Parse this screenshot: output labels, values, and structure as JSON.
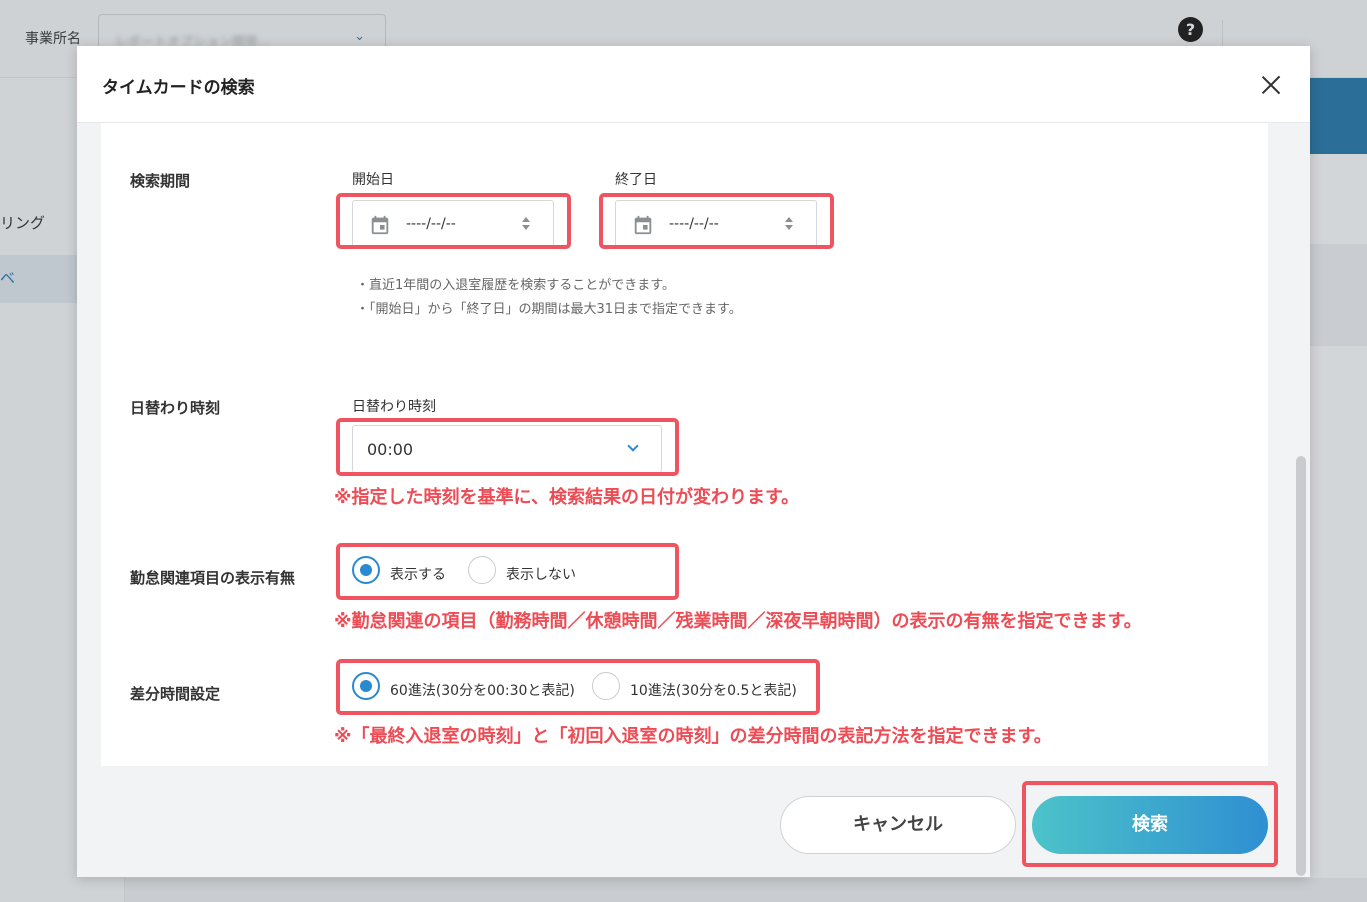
{
  "background": {
    "office_label": "事業所名",
    "office_value": "レポートオプション開発...",
    "help_icon": "?",
    "sidebar_item": "リング",
    "sidebar_active": "ベ"
  },
  "modal": {
    "title": "タイムカードの検索",
    "close_icon": "close-icon"
  },
  "search_period": {
    "label": "検索期間",
    "start_label": "開始日",
    "start_value": "----/--/--",
    "end_label": "終了日",
    "end_value": "----/--/--",
    "hint1": "・直近1年間の入退室履歴を検索することができます。",
    "hint2": "・「開始日」から「終了日」の期間は最大31日まで指定できます。"
  },
  "day_change": {
    "label": "日替わり時刻",
    "sub_label": "日替わり時刻",
    "value": "00:00",
    "note": "※指定した時刻を基準に、検索結果の日付が変わります。"
  },
  "attendance_display": {
    "label": "勤怠関連項目の表示有無",
    "option_show": "表示する",
    "option_hide": "表示しない",
    "selected": "表示する",
    "note": "※勤怠関連の項目（勤務時間／休憩時間／残業時間／深夜早朝時間）の表示の有無を指定できます。"
  },
  "diff_time": {
    "label": "差分時間設定",
    "option_60": "60進法(30分を00:30と表記)",
    "option_10": "10進法(30分を0.5と表記)",
    "selected": "60進法(30分を00:30と表記)",
    "note": "※「最終入退室の時刻」と「初回入退室の時刻」の差分時間の表記方法を指定できます。"
  },
  "buttons": {
    "cancel": "キャンセル",
    "search": "検索"
  },
  "colors": {
    "accent": "#2a8ad0",
    "highlight": "#ee5560",
    "note_red": "#ee4c55",
    "search_gradient_start": "#4cc3c9",
    "search_gradient_end": "#2f8fd2"
  }
}
